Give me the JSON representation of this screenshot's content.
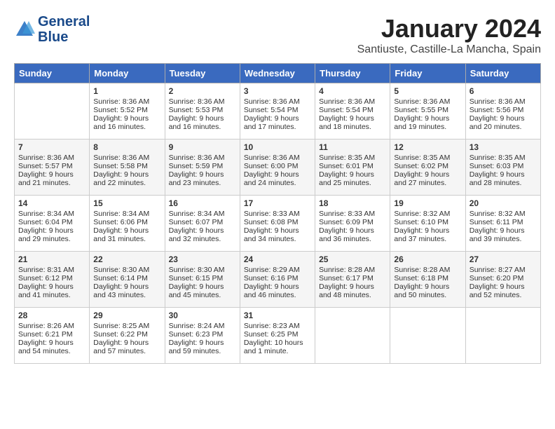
{
  "header": {
    "logo_line1": "General",
    "logo_line2": "Blue",
    "month_title": "January 2024",
    "subtitle": "Santiuste, Castille-La Mancha, Spain"
  },
  "days_of_week": [
    "Sunday",
    "Monday",
    "Tuesday",
    "Wednesday",
    "Thursday",
    "Friday",
    "Saturday"
  ],
  "weeks": [
    [
      {
        "day": "",
        "sunrise": "",
        "sunset": "",
        "daylight": ""
      },
      {
        "day": "1",
        "sunrise": "Sunrise: 8:36 AM",
        "sunset": "Sunset: 5:52 PM",
        "daylight": "Daylight: 9 hours and 16 minutes."
      },
      {
        "day": "2",
        "sunrise": "Sunrise: 8:36 AM",
        "sunset": "Sunset: 5:53 PM",
        "daylight": "Daylight: 9 hours and 16 minutes."
      },
      {
        "day": "3",
        "sunrise": "Sunrise: 8:36 AM",
        "sunset": "Sunset: 5:54 PM",
        "daylight": "Daylight: 9 hours and 17 minutes."
      },
      {
        "day": "4",
        "sunrise": "Sunrise: 8:36 AM",
        "sunset": "Sunset: 5:54 PM",
        "daylight": "Daylight: 9 hours and 18 minutes."
      },
      {
        "day": "5",
        "sunrise": "Sunrise: 8:36 AM",
        "sunset": "Sunset: 5:55 PM",
        "daylight": "Daylight: 9 hours and 19 minutes."
      },
      {
        "day": "6",
        "sunrise": "Sunrise: 8:36 AM",
        "sunset": "Sunset: 5:56 PM",
        "daylight": "Daylight: 9 hours and 20 minutes."
      }
    ],
    [
      {
        "day": "7",
        "sunrise": "Sunrise: 8:36 AM",
        "sunset": "Sunset: 5:57 PM",
        "daylight": "Daylight: 9 hours and 21 minutes."
      },
      {
        "day": "8",
        "sunrise": "Sunrise: 8:36 AM",
        "sunset": "Sunset: 5:58 PM",
        "daylight": "Daylight: 9 hours and 22 minutes."
      },
      {
        "day": "9",
        "sunrise": "Sunrise: 8:36 AM",
        "sunset": "Sunset: 5:59 PM",
        "daylight": "Daylight: 9 hours and 23 minutes."
      },
      {
        "day": "10",
        "sunrise": "Sunrise: 8:36 AM",
        "sunset": "Sunset: 6:00 PM",
        "daylight": "Daylight: 9 hours and 24 minutes."
      },
      {
        "day": "11",
        "sunrise": "Sunrise: 8:35 AM",
        "sunset": "Sunset: 6:01 PM",
        "daylight": "Daylight: 9 hours and 25 minutes."
      },
      {
        "day": "12",
        "sunrise": "Sunrise: 8:35 AM",
        "sunset": "Sunset: 6:02 PM",
        "daylight": "Daylight: 9 hours and 27 minutes."
      },
      {
        "day": "13",
        "sunrise": "Sunrise: 8:35 AM",
        "sunset": "Sunset: 6:03 PM",
        "daylight": "Daylight: 9 hours and 28 minutes."
      }
    ],
    [
      {
        "day": "14",
        "sunrise": "Sunrise: 8:34 AM",
        "sunset": "Sunset: 6:04 PM",
        "daylight": "Daylight: 9 hours and 29 minutes."
      },
      {
        "day": "15",
        "sunrise": "Sunrise: 8:34 AM",
        "sunset": "Sunset: 6:06 PM",
        "daylight": "Daylight: 9 hours and 31 minutes."
      },
      {
        "day": "16",
        "sunrise": "Sunrise: 8:34 AM",
        "sunset": "Sunset: 6:07 PM",
        "daylight": "Daylight: 9 hours and 32 minutes."
      },
      {
        "day": "17",
        "sunrise": "Sunrise: 8:33 AM",
        "sunset": "Sunset: 6:08 PM",
        "daylight": "Daylight: 9 hours and 34 minutes."
      },
      {
        "day": "18",
        "sunrise": "Sunrise: 8:33 AM",
        "sunset": "Sunset: 6:09 PM",
        "daylight": "Daylight: 9 hours and 36 minutes."
      },
      {
        "day": "19",
        "sunrise": "Sunrise: 8:32 AM",
        "sunset": "Sunset: 6:10 PM",
        "daylight": "Daylight: 9 hours and 37 minutes."
      },
      {
        "day": "20",
        "sunrise": "Sunrise: 8:32 AM",
        "sunset": "Sunset: 6:11 PM",
        "daylight": "Daylight: 9 hours and 39 minutes."
      }
    ],
    [
      {
        "day": "21",
        "sunrise": "Sunrise: 8:31 AM",
        "sunset": "Sunset: 6:12 PM",
        "daylight": "Daylight: 9 hours and 41 minutes."
      },
      {
        "day": "22",
        "sunrise": "Sunrise: 8:30 AM",
        "sunset": "Sunset: 6:14 PM",
        "daylight": "Daylight: 9 hours and 43 minutes."
      },
      {
        "day": "23",
        "sunrise": "Sunrise: 8:30 AM",
        "sunset": "Sunset: 6:15 PM",
        "daylight": "Daylight: 9 hours and 45 minutes."
      },
      {
        "day": "24",
        "sunrise": "Sunrise: 8:29 AM",
        "sunset": "Sunset: 6:16 PM",
        "daylight": "Daylight: 9 hours and 46 minutes."
      },
      {
        "day": "25",
        "sunrise": "Sunrise: 8:28 AM",
        "sunset": "Sunset: 6:17 PM",
        "daylight": "Daylight: 9 hours and 48 minutes."
      },
      {
        "day": "26",
        "sunrise": "Sunrise: 8:28 AM",
        "sunset": "Sunset: 6:18 PM",
        "daylight": "Daylight: 9 hours and 50 minutes."
      },
      {
        "day": "27",
        "sunrise": "Sunrise: 8:27 AM",
        "sunset": "Sunset: 6:20 PM",
        "daylight": "Daylight: 9 hours and 52 minutes."
      }
    ],
    [
      {
        "day": "28",
        "sunrise": "Sunrise: 8:26 AM",
        "sunset": "Sunset: 6:21 PM",
        "daylight": "Daylight: 9 hours and 54 minutes."
      },
      {
        "day": "29",
        "sunrise": "Sunrise: 8:25 AM",
        "sunset": "Sunset: 6:22 PM",
        "daylight": "Daylight: 9 hours and 57 minutes."
      },
      {
        "day": "30",
        "sunrise": "Sunrise: 8:24 AM",
        "sunset": "Sunset: 6:23 PM",
        "daylight": "Daylight: 9 hours and 59 minutes."
      },
      {
        "day": "31",
        "sunrise": "Sunrise: 8:23 AM",
        "sunset": "Sunset: 6:25 PM",
        "daylight": "Daylight: 10 hours and 1 minute."
      },
      {
        "day": "",
        "sunrise": "",
        "sunset": "",
        "daylight": ""
      },
      {
        "day": "",
        "sunrise": "",
        "sunset": "",
        "daylight": ""
      },
      {
        "day": "",
        "sunrise": "",
        "sunset": "",
        "daylight": ""
      }
    ]
  ]
}
